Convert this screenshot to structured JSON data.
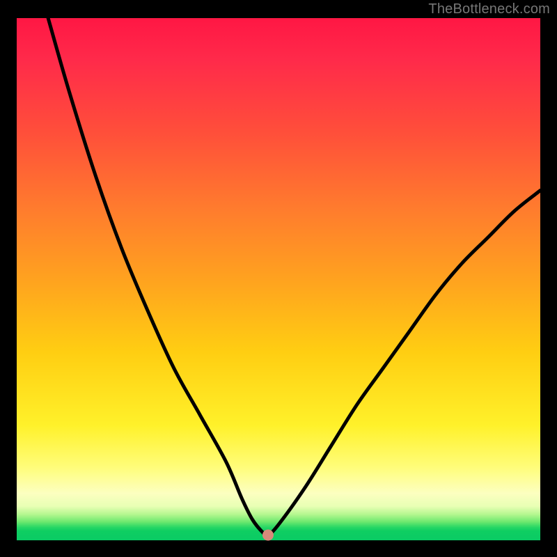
{
  "watermark": "TheBottleneck.com",
  "colors": {
    "frame": "#000000",
    "curve": "#000000",
    "marker": "#d88a7a",
    "gradient_stops": [
      "#ff1744",
      "#ff2a4a",
      "#ff4f3a",
      "#ff7a2e",
      "#ffa21f",
      "#ffce12",
      "#fff12a",
      "#fffd7a",
      "#fcffc0",
      "#e8ffb4",
      "#b6f790",
      "#6be86e",
      "#28d765",
      "#0fce62",
      "#0acb64"
    ]
  },
  "chart_data": {
    "type": "line",
    "title": "",
    "xlabel": "",
    "ylabel": "",
    "xlim": [
      0,
      100
    ],
    "ylim": [
      0,
      100
    ],
    "grid": false,
    "legend": false,
    "marker": {
      "x": 48,
      "y": 1,
      "color": "#d88a7a",
      "radius_px": 8
    },
    "series": [
      {
        "name": "curve",
        "color": "#000000",
        "x": [
          6,
          10,
          15,
          20,
          25,
          30,
          35,
          40,
          43,
          45,
          47,
          48,
          50,
          55,
          60,
          65,
          70,
          75,
          80,
          85,
          90,
          95,
          100
        ],
        "y": [
          100,
          86,
          70,
          56,
          44,
          33,
          24,
          15,
          8,
          4,
          1.5,
          1,
          3,
          10,
          18,
          26,
          33,
          40,
          47,
          53,
          58,
          63,
          67
        ]
      }
    ]
  }
}
